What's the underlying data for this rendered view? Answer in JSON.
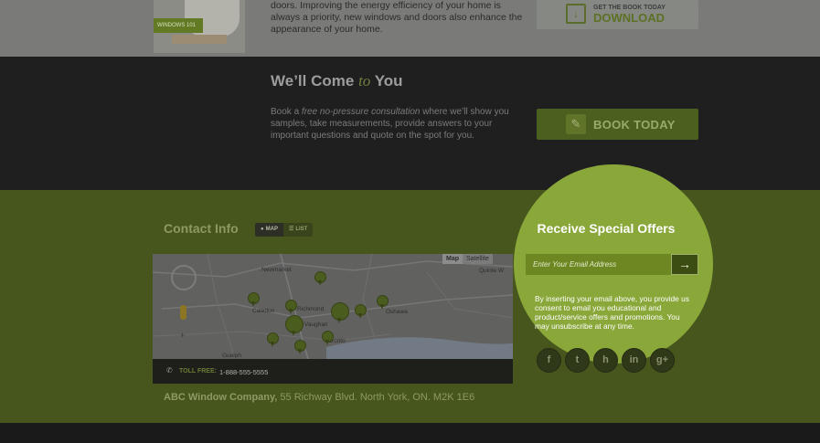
{
  "promo": {
    "book_tag": "WINDOWS 101",
    "description_lines": [
      "doors. Improving the energy efficiency of your home is",
      "always a priority, new windows and doors also enhance the",
      "appearance of your home."
    ],
    "download_small": "GET THE BOOK TODAY",
    "download_label": "DOWNLOAD",
    "download_icon": "download-icon"
  },
  "consult": {
    "title_before": "We’ll Come",
    "title_accent": "to",
    "title_after": "You",
    "text_before": "Book a",
    "text_em": "free no-pressure consultation",
    "text_after": "where we’ll show you samples, take measurements, provide answers to your important questions and quote on the spot for you.",
    "button_label": "BOOK TODAY",
    "button_icon": "pencil-icon"
  },
  "contact": {
    "title": "Contact Info",
    "toggle_map": "MAP",
    "toggle_list": "LIST",
    "map_type_map": "Map",
    "map_type_satellite": "Satellite",
    "places": [
      "Newmarket",
      "Quinte W",
      "Caledon",
      "Richmond",
      "Vaughan",
      "Oshawa",
      "Toronto",
      "Guelph"
    ],
    "toll_label": "TOLL FREE:",
    "toll_number": "1-888-555-5555",
    "company": "ABC Window Company,",
    "address": "55 Richway Blvd. North York, ON. M2K 1E6"
  },
  "offers": {
    "title": "Receive Special Offers",
    "email_placeholder": "Enter Your Email Address",
    "submit_icon": "arrow-right-icon",
    "consent": "By inserting your email above, you provide us consent to email you educational and product/service offers and promotions. You may unsubscribe at any time.",
    "social_icons": [
      "facebook-icon",
      "twitter-icon",
      "houzz-icon",
      "linkedin-icon",
      "google-plus-icon"
    ],
    "social_glyphs": [
      "f",
      "t",
      "h",
      "in",
      "g+"
    ]
  },
  "colors": {
    "brand_green": "#8aa73a",
    "dark_green": "#46561c",
    "dark_band": "#1f1f1f"
  }
}
